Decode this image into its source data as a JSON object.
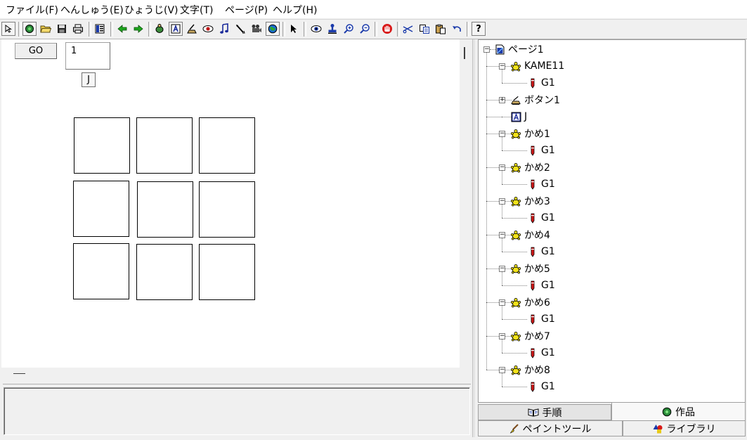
{
  "menu": [
    "ファイル(F)",
    "へんしゅう(E)",
    "ひょうじ(V)",
    "文字(T)",
    "ページ(P)",
    "ヘルプ(H)"
  ],
  "toolbar_help": "?",
  "stage": {
    "go_label": "GO",
    "number_value": "1",
    "j_label": "J"
  },
  "tree": {
    "root": "ページ1",
    "rows": [
      {
        "label": "KAME11",
        "icon": "turtle-icon"
      },
      {
        "label": "G1",
        "icon": "pen-icon"
      },
      {
        "label": "ボタン1",
        "icon": "button-icon"
      },
      {
        "label": "J",
        "icon": "text-object-icon"
      },
      {
        "label": "かめ1",
        "icon": "turtle-icon"
      },
      {
        "label": "G1",
        "icon": "pen-icon"
      },
      {
        "label": "かめ2",
        "icon": "turtle-icon"
      },
      {
        "label": "G1",
        "icon": "pen-icon"
      },
      {
        "label": "かめ3",
        "icon": "turtle-icon"
      },
      {
        "label": "G1",
        "icon": "pen-icon"
      },
      {
        "label": "かめ4",
        "icon": "turtle-icon"
      },
      {
        "label": "G1",
        "icon": "pen-icon"
      },
      {
        "label": "かめ5",
        "icon": "turtle-icon"
      },
      {
        "label": "G1",
        "icon": "pen-icon"
      },
      {
        "label": "かめ6",
        "icon": "turtle-icon"
      },
      {
        "label": "G1",
        "icon": "pen-icon"
      },
      {
        "label": "かめ7",
        "icon": "turtle-icon"
      },
      {
        "label": "G1",
        "icon": "pen-icon"
      },
      {
        "label": "かめ8",
        "icon": "turtle-icon"
      },
      {
        "label": "G1",
        "icon": "pen-icon"
      }
    ]
  },
  "tabs": {
    "procedure": "手順",
    "work": "作品",
    "paint_tool": "ペイントツール",
    "library": "ライブラリ"
  },
  "colors": {
    "turtle": "#f2e21a",
    "pen": "#d01818",
    "text_object": "#1a2a9a"
  }
}
